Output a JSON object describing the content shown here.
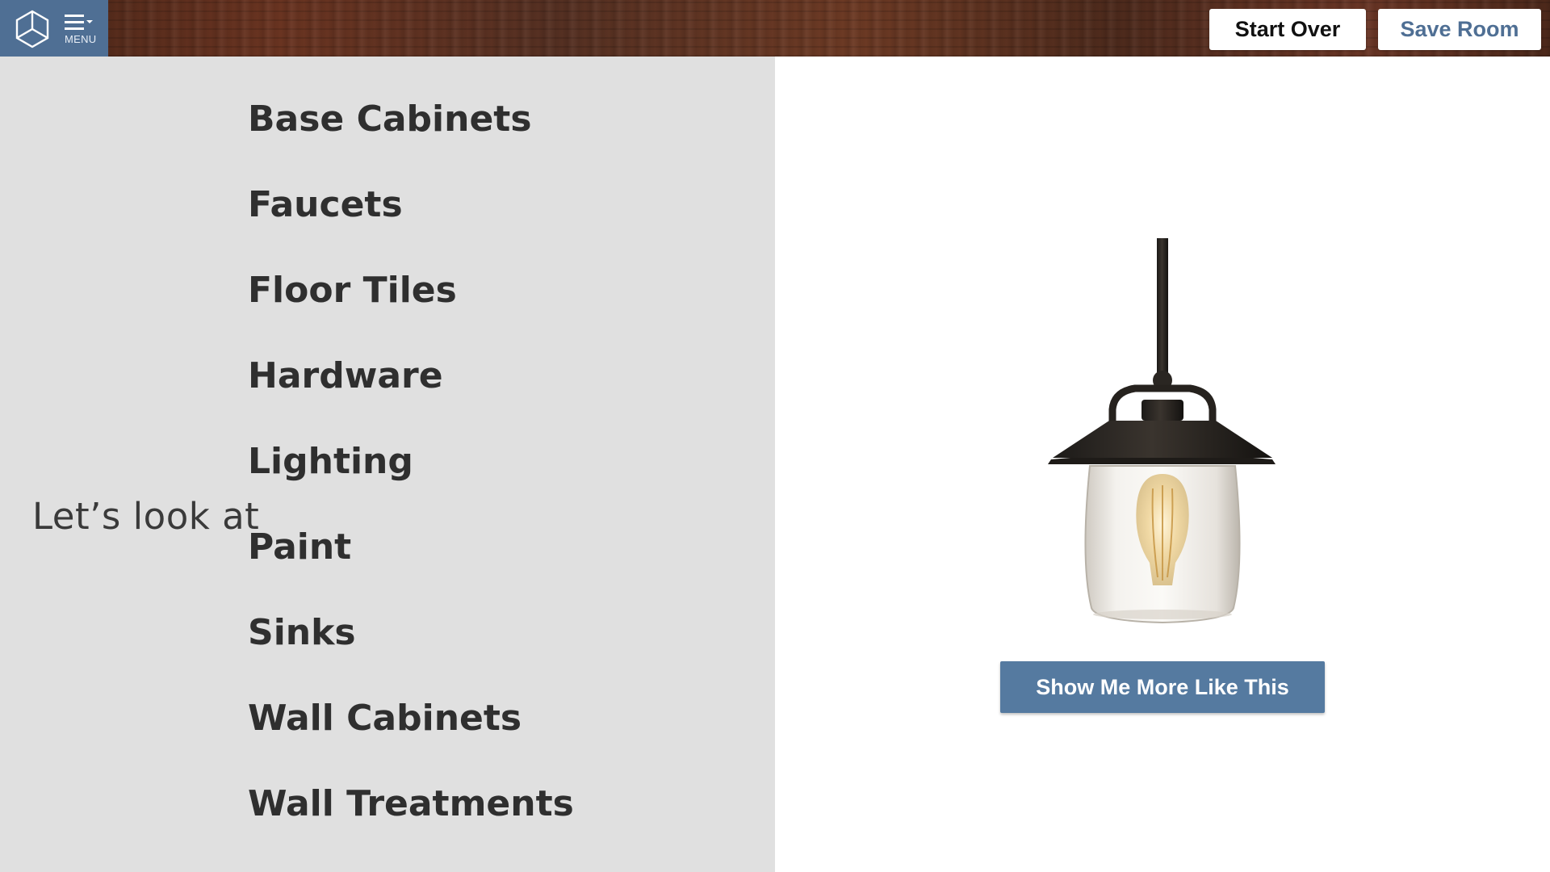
{
  "header": {
    "menu_label": "MENU",
    "start_over_label": "Start Over",
    "save_room_label": "Save Room",
    "logo_icon": "cube-logo-icon",
    "menu_icon": "hamburger-menu-icon"
  },
  "chooser": {
    "lead_text": "Let’s look at",
    "categories": [
      "Base Cabinets",
      "Faucets",
      "Floor Tiles",
      "Hardware",
      "Lighting",
      "Paint",
      "Sinks",
      "Wall Cabinets",
      "Wall Treatments"
    ],
    "selected_category": "Lighting"
  },
  "product": {
    "image_icon": "pendant-lamp-image",
    "more_button_label": "Show Me More Like This"
  },
  "colors": {
    "menu_block": "#4f6f94",
    "accent_button": "#557aa0",
    "left_panel": "#e0e0e0"
  }
}
